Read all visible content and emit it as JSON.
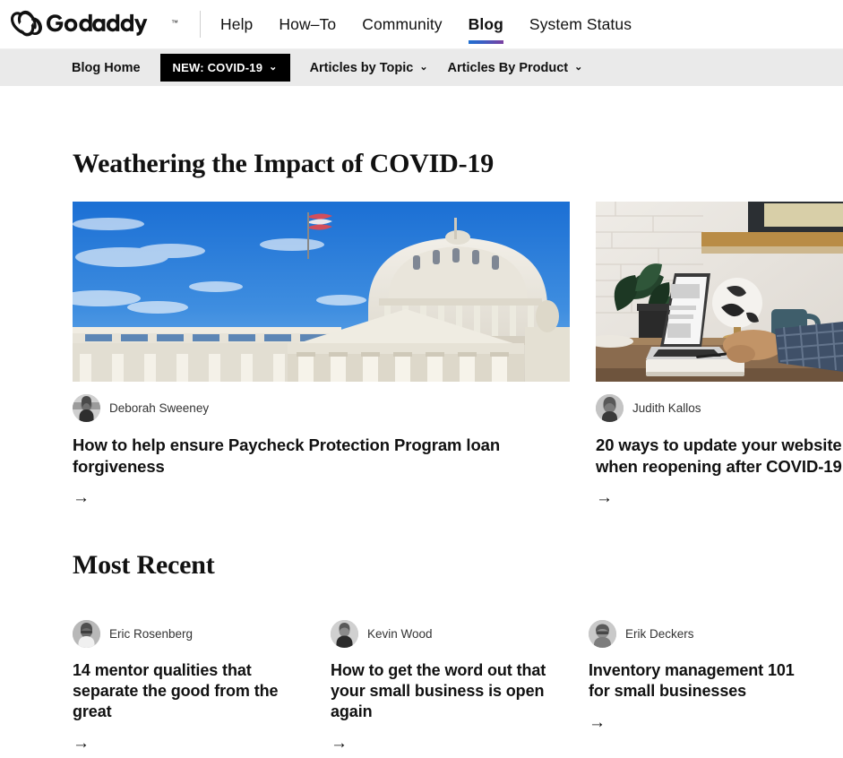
{
  "brand": {
    "name": "GoDaddy",
    "trademark": "™",
    "logo_icon": "godaddy-heart-logo",
    "active_underline_gradient_from": "#1f6fd0",
    "active_underline_gradient_to": "#7b3fa0"
  },
  "main_nav": {
    "items": [
      {
        "label": "Help",
        "active": false
      },
      {
        "label": "How–To",
        "active": false
      },
      {
        "label": "Community",
        "active": false
      },
      {
        "label": "Blog",
        "active": true
      },
      {
        "label": "System Status",
        "active": false
      }
    ]
  },
  "sub_nav": {
    "background": "#eaeaea",
    "items": [
      {
        "label": "Blog Home",
        "style": "plain",
        "chevron": ""
      },
      {
        "label": "NEW: COVID-19",
        "style": "pill",
        "chevron": "⌄"
      },
      {
        "label": "Articles by Topic",
        "style": "plain",
        "chevron": "⌄"
      },
      {
        "label": "Articles By Product",
        "style": "plain",
        "chevron": "⌄"
      }
    ]
  },
  "sections": [
    {
      "title": "Weathering the Impact of COVID-19",
      "layout": "featured",
      "cards": [
        {
          "hero": "us-capitol-building-blue-sky",
          "author": "Deborah Sweeney",
          "avatar": "author-avatar-deborah-sweeney",
          "title": "How to help ensure Paycheck Protection Program loan forgiveness",
          "arrow": "→"
        },
        {
          "hero": "person-working-on-laptop-at-desk",
          "author": "Judith Kallos",
          "avatar": "author-avatar-judith-kallos",
          "title": "20 ways to update your website when reopening after COVID-19",
          "arrow": "→"
        }
      ]
    },
    {
      "title": "Most Recent",
      "layout": "recent",
      "cards": [
        {
          "author": "Eric Rosenberg",
          "avatar": "author-avatar-eric-rosenberg",
          "title": "14 mentor qualities that separate the good from the great",
          "arrow": "→"
        },
        {
          "author": "Kevin Wood",
          "avatar": "author-avatar-kevin-wood",
          "title": "How to get the word out that your small business is open again",
          "arrow": "→"
        },
        {
          "author": "Erik Deckers",
          "avatar": "author-avatar-erik-deckers",
          "title": "Inventory management 101 for small businesses",
          "arrow": "→"
        }
      ]
    }
  ]
}
